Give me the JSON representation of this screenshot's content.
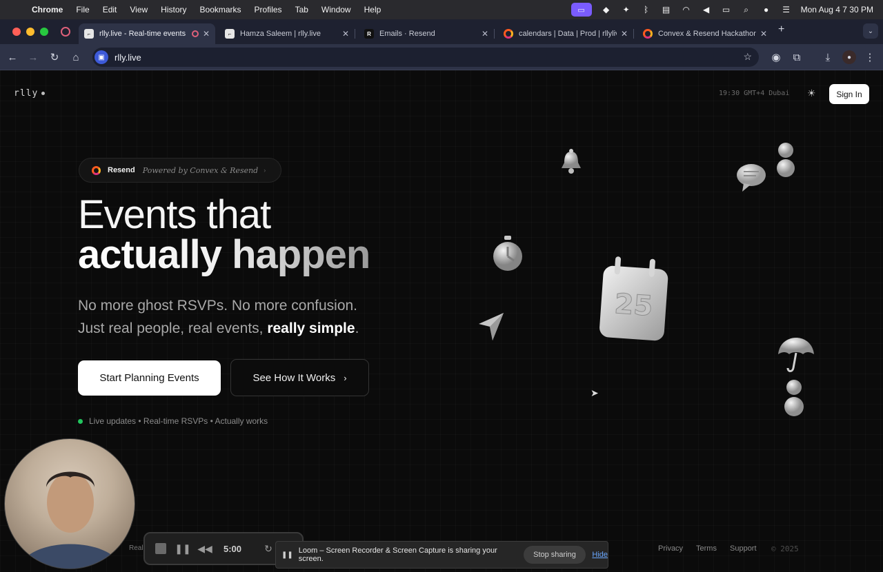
{
  "menubar": {
    "app": "Chrome",
    "items": [
      "File",
      "Edit",
      "View",
      "History",
      "Bookmarks",
      "Profiles",
      "Tab",
      "Window",
      "Help"
    ],
    "datetime": "Mon Aug 4  7 30 PM"
  },
  "tabs": [
    {
      "title": "rlly.live - Real-time events",
      "active": true
    },
    {
      "title": "Hamza Saleem | rlly.live"
    },
    {
      "title": "Emails · Resend"
    },
    {
      "title": "calendars | Data | Prod | rllyliv"
    },
    {
      "title": "Convex & Resend Hackathon"
    }
  ],
  "toolbar": {
    "url": "rlly.live"
  },
  "page": {
    "logo": "rlly",
    "clock": "19:30 GMT+4 Dubai",
    "signin": "Sign In",
    "pill": {
      "brand": "Resend",
      "tagline": "Powered by Convex & Resend"
    },
    "headline1": "Events that",
    "headline2": "actually happen",
    "sub1": "No more ghost RSVPs. No more confusion.",
    "sub2_prefix": "Just real people, real events, ",
    "sub2_em": "really simple",
    "sub2_suffix": ".",
    "cta_primary": "Start Planning Events",
    "cta_secondary": "See How It Works",
    "live_text": "Live updates • Real-time RSVPs • Actually works",
    "calendar_number": "25",
    "footer": {
      "privacy": "Privacy",
      "terms": "Terms",
      "support": "Support",
      "copyright": "© 2025"
    }
  },
  "overlays": {
    "recorder_time": "5:00",
    "left_text": "Real",
    "share_message": "Loom – Screen Recorder & Screen Capture is sharing your screen.",
    "stop_sharing": "Stop sharing",
    "hide": "Hide"
  },
  "colors": {
    "accent_green": "#22c55e",
    "loom_purple": "#7a5cff",
    "link_blue": "#6aa8ff"
  }
}
